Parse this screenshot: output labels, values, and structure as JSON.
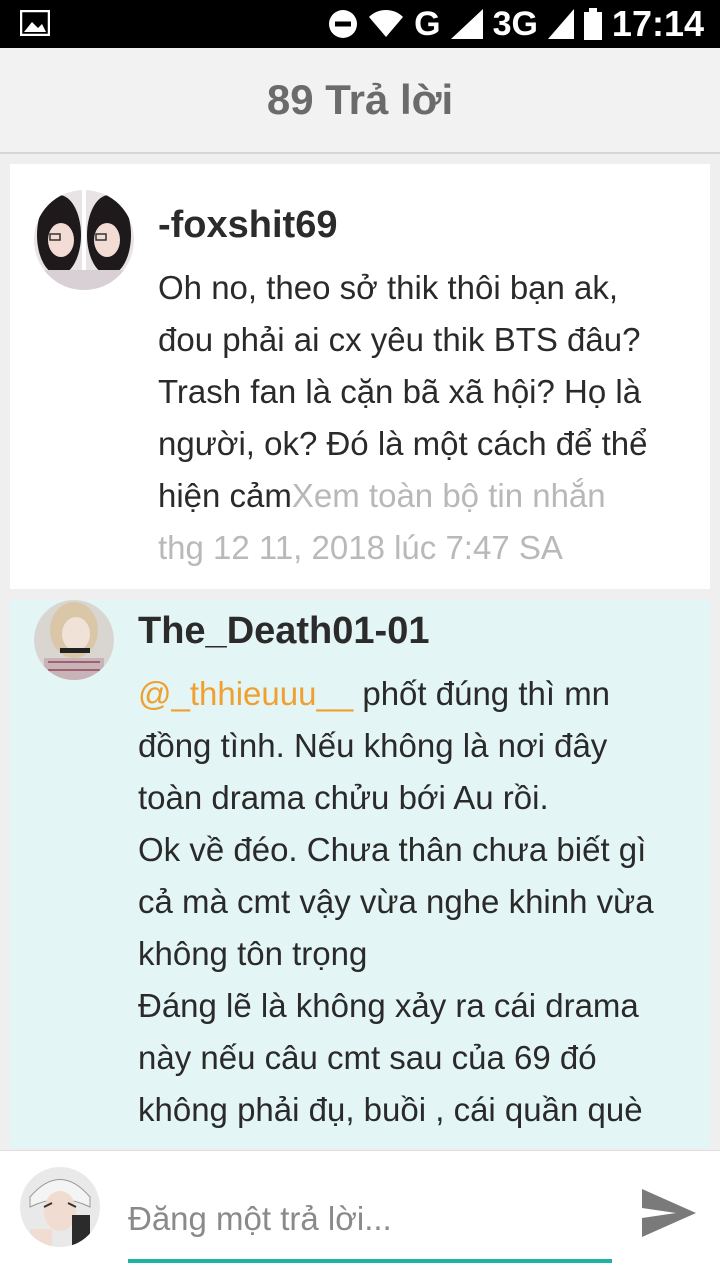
{
  "statusbar": {
    "network": "G",
    "network2": "3G",
    "time": "17:14"
  },
  "header": {
    "title": "89 Trả lời"
  },
  "comments": [
    {
      "username": "-foxshit69",
      "text_lines": [
        "Oh no, theo sở thik thôi bạn ak,",
        "đou phải ai cx yêu thik BTS đâu?",
        "Trash fan là cặn bã xã hội? Họ là",
        "người, ok? Đó là một cách để thể",
        "hiện cảm"
      ],
      "see_more": "Xem toàn bộ tin nhắn",
      "timestamp": "thg 12 11, 2018 lúc 7:47 SA"
    },
    {
      "username": "The_Death01-01",
      "mention": "@_thhieuuu__",
      "first_line_rest": " phốt đúng thì mn",
      "text_lines": [
        "đồng tình. Nếu không là nơi đây",
        "toàn drama chửu bới Au rồi.",
        "Ok về đéo. Chưa thân chưa biết gì",
        "cả mà cmt vậy vừa nghe khinh vừa",
        "không tôn trọng",
        "Đáng lẽ là không xảy ra cái drama",
        "này nếu câu cmt sau của 69 đó",
        "không phải đụ, buồi , cái quần què"
      ]
    }
  ],
  "composer": {
    "placeholder": "Đăng một trả lời..."
  },
  "colors": {
    "accent": "#1fb2a6",
    "mention": "#f0a030",
    "highlight_bg": "#e4f5f6"
  }
}
